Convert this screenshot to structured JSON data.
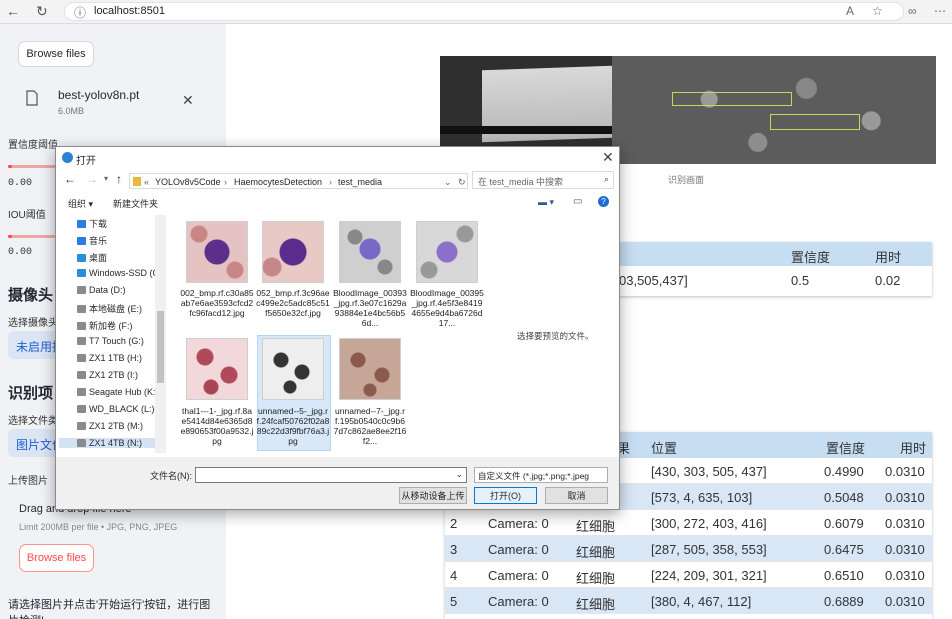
{
  "browser": {
    "url": "localhost:8501"
  },
  "sidebar": {
    "browse_top": "Browse files",
    "uploaded_file": {
      "name": "best-yolov8n.pt",
      "size": "6.0MB"
    },
    "conf_label": "置信度阈值",
    "conf_value": "0.00",
    "iou_label": "IOU阈值",
    "iou_value": "0.00",
    "camera_header": "摄像头",
    "camera_select_label": "选择摄像头",
    "camera_select_value": "未启用摄",
    "project_header": "识别项目",
    "file_type_label": "选择文件类",
    "file_type_value": "图片文件",
    "upload_label": "上传图片",
    "drag_text": "Drag and drop file here",
    "limit_text": "Limit 200MB per file • JPG, PNG, JPEG",
    "browse_bottom": "Browse files",
    "hint": "请选择图片并点击'开始运行'按钮，进行图片检测!"
  },
  "main": {
    "video_caption": "识别画面",
    "table1": {
      "headers": [
        "置信度",
        "用时"
      ],
      "row": [
        "03,505,437]",
        "0.5",
        "0.02"
      ]
    },
    "table2": {
      "headers": [
        "果",
        "位置",
        "置信度",
        "用时"
      ],
      "rows": [
        {
          "idx": "",
          "cam": "",
          "cls": "",
          "pos": "[430, 303, 505, 437]",
          "conf": "0.4990",
          "time": "0.0310"
        },
        {
          "idx": "",
          "cam": "",
          "cls": "",
          "pos": "[573, 4, 635, 103]",
          "conf": "0.5048",
          "time": "0.0310"
        },
        {
          "idx": "2",
          "cam": "Camera: 0",
          "cls": "红细胞",
          "pos": "[300, 272, 403, 416]",
          "conf": "0.6079",
          "time": "0.0310"
        },
        {
          "idx": "3",
          "cam": "Camera: 0",
          "cls": "红细胞",
          "pos": "[287, 505, 358, 553]",
          "conf": "0.6475",
          "time": "0.0310"
        },
        {
          "idx": "4",
          "cam": "Camera: 0",
          "cls": "红细胞",
          "pos": "[224, 209, 301, 321]",
          "conf": "0.6510",
          "time": "0.0310"
        },
        {
          "idx": "5",
          "cam": "Camera: 0",
          "cls": "红细胞",
          "pos": "[380, 4, 467, 112]",
          "conf": "0.6889",
          "time": "0.0310"
        }
      ]
    }
  },
  "dialog": {
    "title": "打开",
    "breadcrumbs": [
      "YOLOv8v5Code",
      "HaemocytesDetection",
      "test_media"
    ],
    "search_placeholder": "在 test_media 中搜索",
    "organize": "组织 ▾",
    "new_folder": "新建文件夹",
    "tree": [
      "下载",
      "音乐",
      "桌面",
      "Windows-SSD (C",
      "Data (D:)",
      "本地磁盘 (E:)",
      "新加卷 (F:)",
      "T7 Touch (G:)",
      "ZX1 1TB (H:)",
      "ZX1 2TB (I:)",
      "Seagate Hub (K:",
      "WD_BLACK (L:)",
      "ZX1 2TB (M:)",
      "ZX1 4TB (N:)"
    ],
    "files": [
      "002_bmp.rf.c30a85ab7e6ae3593cfcd2fc96facd12.jpg",
      "052_bmp.rf.3c96aec499e2c5adc85c51f5650e32cf.jpg",
      "BloodImage_00393_jpg.rf.3e07c1629a93884e1e4bc56b56d...",
      "BloodImage_00395_jpg.rf.4e5f3e84194655e9d4ba6726d17...",
      "thal1---1-_jpg.rf.8ae5414d84e6365d8e890653f00a9532.jpg",
      "unnamed--5-_jpg.rf.24fcaf50762f02a889c22d3f9fbf76a3.jpg",
      "unnamed--7-_jpg.rf.195b0540c0c9b67d7c862ae8ee2f16f2..."
    ],
    "preview_text": "选择要预览的文件。",
    "filename_label": "文件名(N):",
    "filter": "自定义文件 (*.jpg;*.png;*.jpeg",
    "btn_mobile": "从移动设备上传",
    "btn_open": "打开(O)",
    "btn_cancel": "取消"
  }
}
